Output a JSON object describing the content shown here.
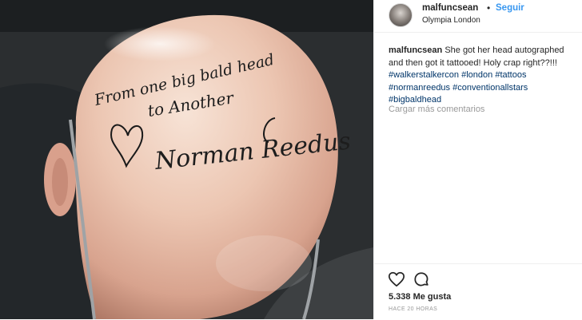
{
  "post": {
    "username": "malfuncsean",
    "separator": "•",
    "follow_label": "Seguir",
    "location": "Olympia London"
  },
  "caption": {
    "username": "malfuncsean",
    "text": "She got her head autographed and then got it tattooed! Holy crap right??!!!",
    "hashtags": [
      "#walkerstalkercon",
      "#london",
      "#tattoos",
      "#normanreedus",
      "#conventionallstars",
      "#bigbaldhead"
    ]
  },
  "comments": {
    "load_more_label": "Cargar más comentarios"
  },
  "stats": {
    "likes_label": "5.338 Me gusta",
    "time_label": "HACE 20 HORAS"
  },
  "icons": {
    "like": "heart-icon",
    "comment": "comment-bubble-icon"
  },
  "colors": {
    "link": "#3897f0",
    "hashtag": "#003569",
    "muted": "#999999",
    "text": "#262626"
  },
  "photo": {
    "tattoo_line1": "From one big bald head",
    "tattoo_line2": "to Another",
    "signature": "Norman Reedus"
  }
}
